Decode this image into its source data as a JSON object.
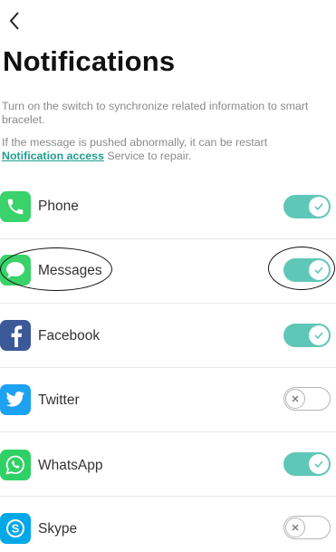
{
  "header": {
    "back_icon": "chevron-left-icon",
    "title": "Notifications"
  },
  "description": {
    "line1": "Turn on the switch to synchronize related information to smart bracelet.",
    "line2_pre": "If the message is pushed abnormally, it can be restart ",
    "link_text": "Notification access",
    "line2_post": " Service to repair."
  },
  "apps": [
    {
      "label": "Phone",
      "icon": "phone-icon",
      "enabled": true
    },
    {
      "label": "Messages",
      "icon": "messages-icon",
      "enabled": true
    },
    {
      "label": "Facebook",
      "icon": "facebook-icon",
      "enabled": true
    },
    {
      "label": "Twitter",
      "icon": "twitter-icon",
      "enabled": false
    },
    {
      "label": "WhatsApp",
      "icon": "whatsapp-icon",
      "enabled": true
    },
    {
      "label": "Skype",
      "icon": "skype-icon",
      "enabled": false
    }
  ],
  "colors": {
    "accent": "#5fc7b7",
    "link": "#1f9e8c",
    "phone": "#3ad26a",
    "messages": "#3ad26a",
    "facebook": "#3b5998",
    "twitter": "#1da1f2",
    "whatsapp": "#2fd065",
    "skype": "#00a8e8"
  }
}
